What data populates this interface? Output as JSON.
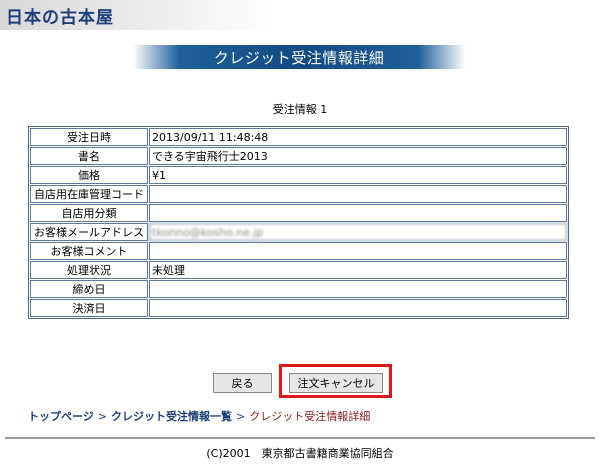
{
  "header": {
    "logo": "日本の古本屋"
  },
  "title": "クレジット受注情報詳細",
  "subtitle": "受注情報 1",
  "rows": [
    {
      "label": "受注日時",
      "value": "2013/09/11 11:48:48",
      "blurred": false
    },
    {
      "label": "書名",
      "value": "できる宇宙飛行士2013",
      "blurred": false
    },
    {
      "label": "価格",
      "value": "¥1",
      "blurred": false
    },
    {
      "label": "自店用在庫管理コード",
      "value": "",
      "blurred": false
    },
    {
      "label": "自店用分類",
      "value": "",
      "blurred": false
    },
    {
      "label": "お客様メールアドレス",
      "value": "tkonno@kosho.ne.jp",
      "blurred": true
    },
    {
      "label": "お客様コメント",
      "value": "",
      "blurred": false
    },
    {
      "label": "処理状況",
      "value": "未処理",
      "blurred": false
    },
    {
      "label": "締め日",
      "value": "",
      "blurred": false
    },
    {
      "label": "決済日",
      "value": "",
      "blurred": false
    }
  ],
  "buttons": {
    "back": "戻る",
    "cancel": "注文キャンセル"
  },
  "breadcrumb": {
    "top": "トップページ",
    "list": "クレジット受注情報一覧",
    "current": "クレジット受注情報詳細",
    "separator": ">"
  },
  "footer": "(C)2001　東京都古書籍商業協同組合",
  "colors": {
    "title_bar": "#124a82",
    "highlight": "#e01818",
    "link": "#1c3f7a",
    "current": "#8a1c1c"
  }
}
